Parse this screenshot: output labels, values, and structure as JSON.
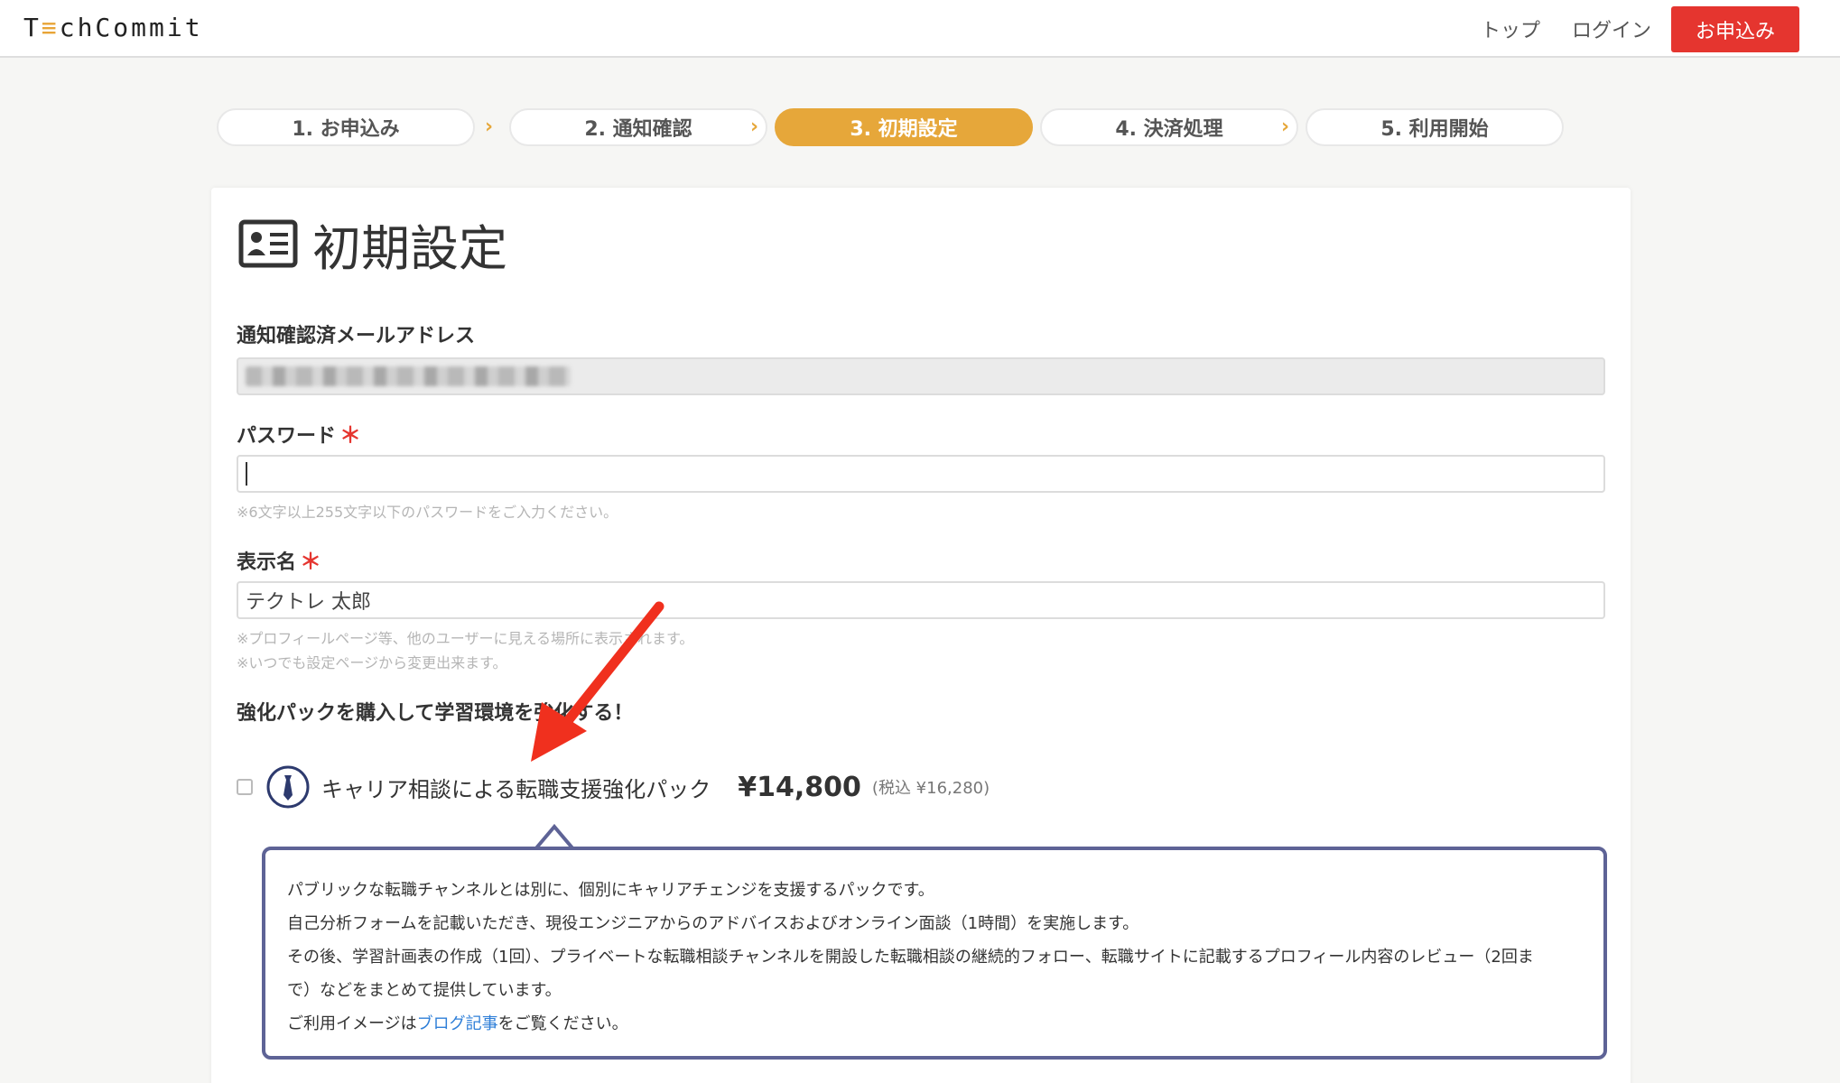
{
  "header": {
    "logo_text_t": "T",
    "logo_text_mark": "≡",
    "logo_text_rest": "chCommit",
    "nav_top": "トップ",
    "nav_login": "ログイン",
    "apply_label": "お申込み"
  },
  "steps": [
    {
      "label": "1. お申込み",
      "active": false
    },
    {
      "label": "2. 通知確認",
      "active": false
    },
    {
      "label": "3. 初期設定",
      "active": true
    },
    {
      "label": "4. 決済処理",
      "active": false
    },
    {
      "label": "5. 利用開始",
      "active": false
    }
  ],
  "step_arrow": "›",
  "page": {
    "title": "初期設定",
    "title_icon": "id-card-icon"
  },
  "form": {
    "email_label": "通知確認済メールアドレス",
    "password_label": "パスワード",
    "required_mark": "＊",
    "password_value": "",
    "password_hint": "※6文字以上255文字以下のパスワードをご入力ください。",
    "display_name_label": "表示名",
    "display_name_value": "テクトレ 太郎",
    "display_name_hint_1": "※プロフィールページ等、他のユーザーに見える場所に表示されます。",
    "display_name_hint_2": "※いつでも設定ページから変更出来ます。"
  },
  "pack": {
    "heading": "強化パックを購入して学習環境を強化する！",
    "name": "キャリア相談による転職支援強化パック",
    "price": "¥14,800",
    "tax": "(税込 ¥16,280)",
    "checked": false,
    "icon": "tie-icon",
    "desc_line_1": "パブリックな転職チャンネルとは別に、個別にキャリアチェンジを支援するパックです。",
    "desc_line_2": "自己分析フォームを記載いただき、現役エンジニアからのアドバイスおよびオンライン面談（1時間）を実施します。",
    "desc_line_3": "その後、学習計画表の作成（1回）、プライベートな転職相談チャンネルを開設した転職相談の継続的フォロー、転職サイトに記載するプロフィール内容のレビュー（2回ま",
    "desc_line_4": "で）などをまとめて提供しています。",
    "desc_line_5_pre": "ご利用イメージは",
    "desc_link": "ブログ記事",
    "desc_line_5_post": "をご覧ください。"
  },
  "colors": {
    "accent_orange": "#e6a73a",
    "brand_red": "#e5352f",
    "box_border": "#5e6396",
    "link_blue": "#2f7fd8",
    "annotation_red": "#f0301e"
  }
}
